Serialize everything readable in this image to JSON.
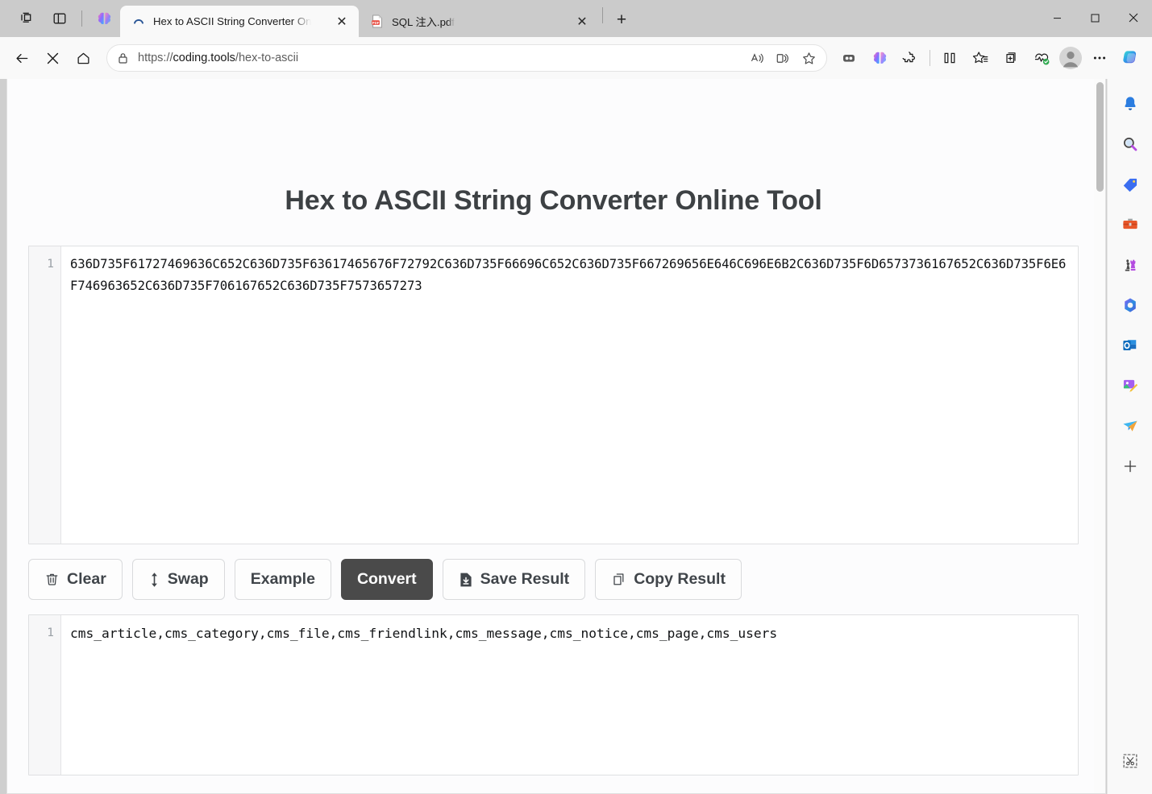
{
  "browser": {
    "tabbar_icons": [
      {
        "name": "workspaces-icon",
        "label": "Workspaces"
      },
      {
        "name": "tab-actions-icon",
        "label": "Tab actions menu"
      },
      {
        "name": "copilot-brain-icon",
        "label": "Copilot"
      }
    ],
    "tabs": [
      {
        "title": "Hex to ASCII String Converter On",
        "favicon": "loading-spinner-icon",
        "active": true,
        "close_label": "✕"
      },
      {
        "title": "SQL 注入.pdf",
        "favicon": "pdf-icon",
        "active": false,
        "close_label": "✕"
      }
    ],
    "new_tab_label": "+",
    "window_controls": {
      "minimize": "—",
      "maximize": "□",
      "close": "✕"
    },
    "nav": {
      "back_label": "←",
      "stop_label": "✕",
      "home_label": "Home"
    },
    "address": {
      "scheme_prefix": "https://",
      "host": "coding.tools",
      "path": "/hex-to-ascii",
      "full_url": "https://coding.tools/hex-to-ascii",
      "lock_icon": "lock-icon"
    },
    "omnibox_icons": [
      {
        "name": "read-aloud-icon"
      },
      {
        "name": "immersive-reader-icon"
      },
      {
        "name": "favorite-star-icon"
      }
    ],
    "toolbar_icons": [
      {
        "name": "split-screen-tabs-icon"
      },
      {
        "name": "copilot-brain-icon"
      },
      {
        "name": "extensions-puzzle-icon"
      },
      {
        "name": "split-screen-icon"
      },
      {
        "name": "collections-favorites-icon"
      },
      {
        "name": "collections-icon"
      },
      {
        "name": "browser-essentials-icon"
      },
      {
        "name": "profile-avatar-icon"
      },
      {
        "name": "settings-more-icon"
      },
      {
        "name": "copilot-sidebar-icon"
      }
    ]
  },
  "sidebar": {
    "items": [
      {
        "name": "notifications-bell-icon"
      },
      {
        "name": "search-magnifier-icon"
      },
      {
        "name": "shopping-tag-icon"
      },
      {
        "name": "tools-briefcase-icon"
      },
      {
        "name": "games-chess-icon"
      },
      {
        "name": "microsoft-365-icon"
      },
      {
        "name": "outlook-icon"
      },
      {
        "name": "image-creator-icon"
      },
      {
        "name": "drop-paper-plane-icon"
      },
      {
        "name": "add-sidebar-app-icon"
      }
    ],
    "bottom_item": {
      "name": "screenshot-scissors-icon"
    }
  },
  "page": {
    "title": "Hex to ASCII String Converter Online Tool",
    "input": {
      "line_number": "1",
      "value": "636D735F61727469636C652C636D735F63617465676F72792C636D735F66696C652C636D735F667269656E646C696E6B2C636D735F6D6573736167652C636D735F6E6F746963652C636D735F706167652C636D735F7573657273"
    },
    "buttons": [
      {
        "label": "Clear",
        "icon": "trash-icon",
        "primary": false
      },
      {
        "label": "Swap",
        "icon": "swap-vertical-icon",
        "primary": false
      },
      {
        "label": "Example",
        "icon": "",
        "primary": false
      },
      {
        "label": "Convert",
        "icon": "",
        "primary": true
      },
      {
        "label": "Save Result",
        "icon": "save-file-icon",
        "primary": false
      },
      {
        "label": "Copy Result",
        "icon": "copy-icon",
        "primary": false
      }
    ],
    "output": {
      "line_number": "1",
      "value": "cms_article,cms_category,cms_file,cms_friendlink,cms_message,cms_notice,cms_page,cms_users"
    }
  },
  "colors": {
    "primary_button": "#4a4a4a",
    "title_text": "#3d4144",
    "tabbar_bg": "#cbcbcb",
    "toolbar_bg": "#f9f9f9"
  }
}
